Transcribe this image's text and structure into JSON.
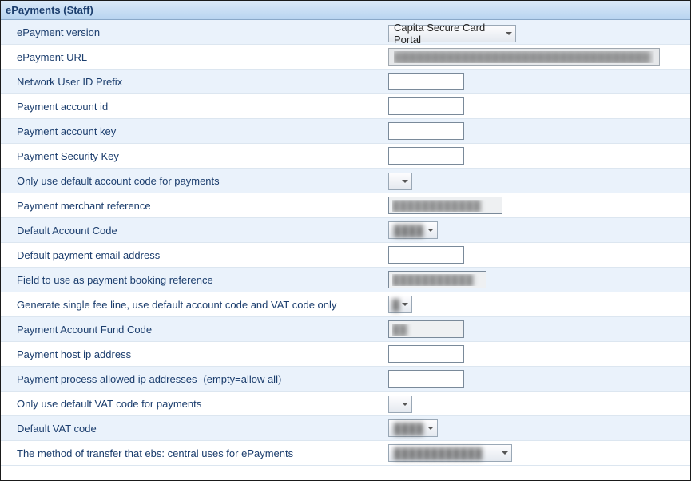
{
  "panel": {
    "title": "ePayments (Staff)"
  },
  "rows": [
    {
      "label": "ePayment version",
      "type": "select",
      "size": "xl",
      "value": "Capita Secure Card Portal"
    },
    {
      "label": "ePayment URL",
      "type": "wide",
      "value": "██████████████████████████████████"
    },
    {
      "label": "Network User ID Prefix",
      "type": "text",
      "value": ""
    },
    {
      "label": "Payment account id",
      "type": "text",
      "value": ""
    },
    {
      "label": "Payment account key",
      "type": "text",
      "value": ""
    },
    {
      "label": "Payment Security Key",
      "type": "text",
      "value": ""
    },
    {
      "label": "Only use default account code for payments",
      "type": "select-small",
      "value": ""
    },
    {
      "label": "Payment merchant reference",
      "type": "text-blur",
      "width": 143,
      "value": "████████████"
    },
    {
      "label": "Default Account Code",
      "type": "select-blur",
      "size": "med",
      "value": "████"
    },
    {
      "label": "Default payment email address",
      "type": "text",
      "value": ""
    },
    {
      "label": "Field to use as payment booking reference",
      "type": "text-blur",
      "width": 123,
      "value": "███████████"
    },
    {
      "label": "Generate single fee line, use default account code and VAT code only",
      "type": "select-small-blur",
      "value": "█"
    },
    {
      "label": "Payment Account Fund Code",
      "type": "text-blur",
      "width": 95,
      "value": "██"
    },
    {
      "label": "Payment host ip address",
      "type": "text",
      "value": ""
    },
    {
      "label": "Payment process allowed ip addresses -(empty=allow all)",
      "type": "text",
      "value": ""
    },
    {
      "label": "Only use default VAT code for payments",
      "type": "select-small",
      "value": ""
    },
    {
      "label": "Default VAT code",
      "type": "select-blur",
      "size": "med",
      "value": "████"
    },
    {
      "label": "The method of transfer that ebs: central uses for ePayments",
      "type": "select-blur",
      "size": "lg",
      "value": "████████████"
    }
  ]
}
